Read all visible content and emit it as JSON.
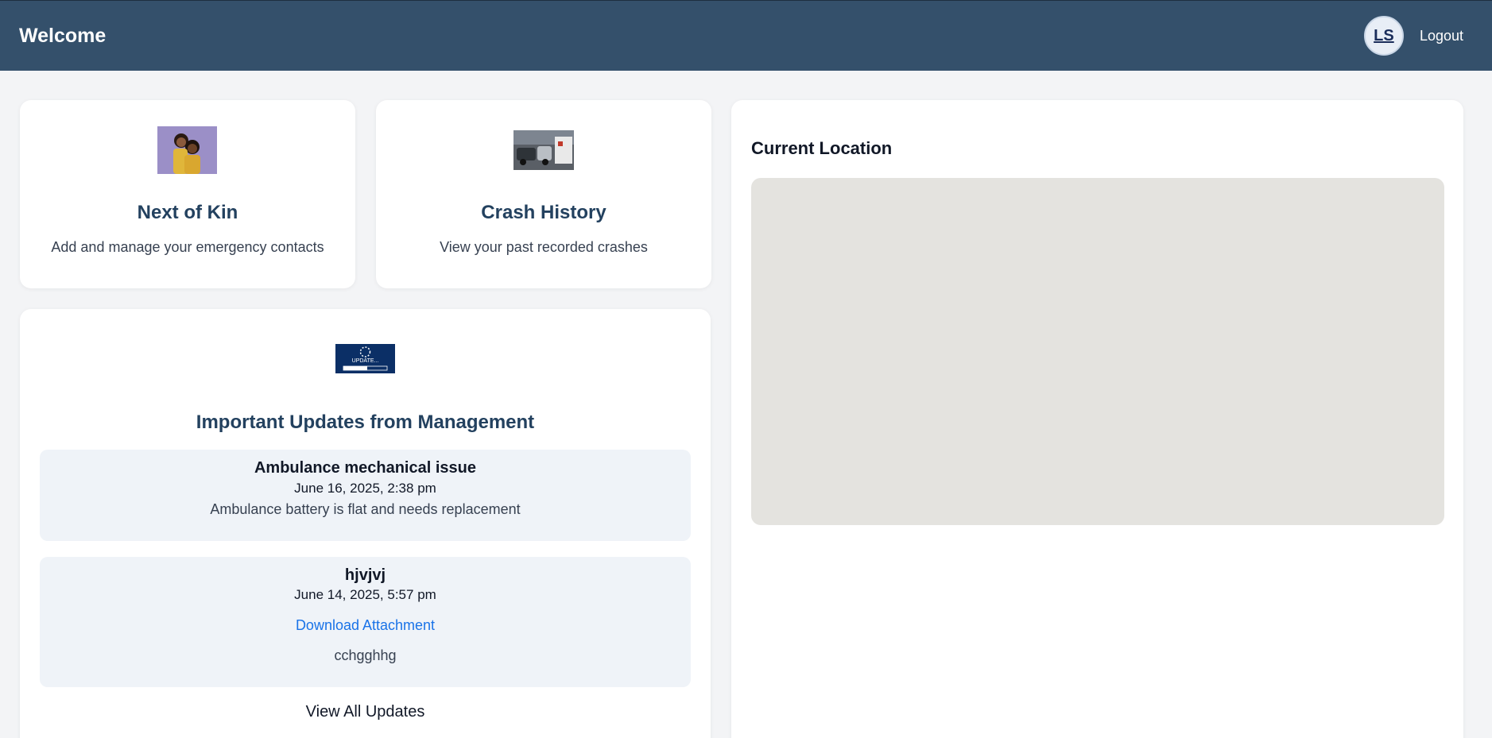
{
  "header": {
    "title": "Welcome",
    "avatar_initials": "LS",
    "logout_label": "Logout"
  },
  "cards": {
    "next_of_kin": {
      "title": "Next of Kin",
      "description": "Add and manage your emergency contacts"
    },
    "crash_history": {
      "title": "Crash History",
      "description": "View your past recorded crashes"
    }
  },
  "updates": {
    "heading": "Important Updates from Management",
    "image_text": "UPDATE...",
    "items": [
      {
        "title": "Ambulance mechanical issue",
        "date": "June 16, 2025, 2:38 pm",
        "body": "Ambulance battery is flat and needs replacement"
      },
      {
        "title": "hjvjvj",
        "date": "June 14, 2025, 5:57 pm",
        "link": "Download Attachment",
        "body": "cchgghhg"
      }
    ],
    "view_all_label": "View All Updates"
  },
  "location": {
    "heading": "Current Location"
  },
  "colors": {
    "header_bg": "#34506b",
    "card_title": "#23415f",
    "link": "#1a73e8",
    "map_bg": "#e4e3df"
  }
}
